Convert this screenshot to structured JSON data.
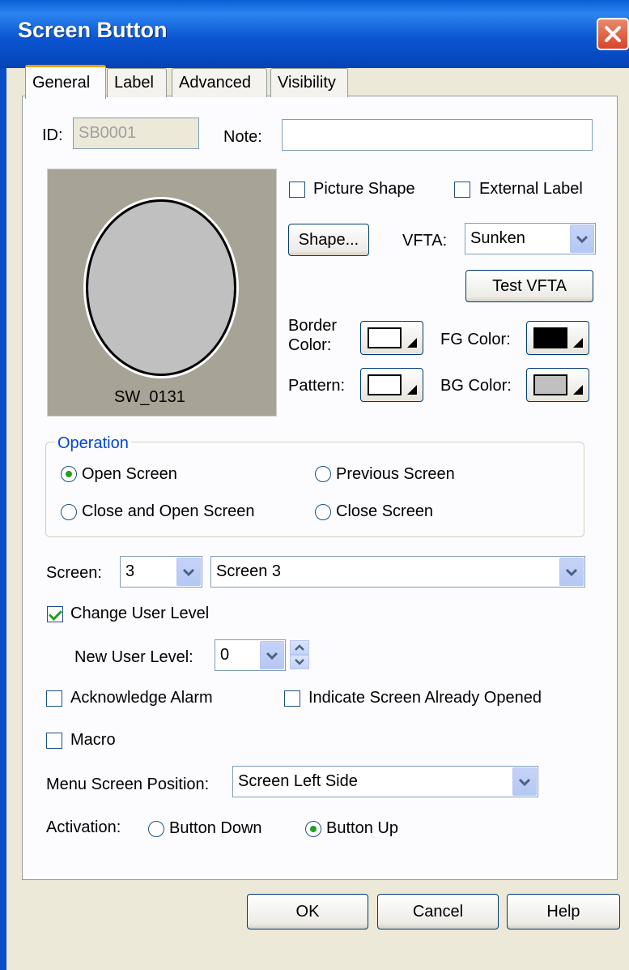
{
  "window": {
    "title": "Screen Button",
    "close_label": "Close"
  },
  "tabs": [
    {
      "label": "General",
      "active": true
    },
    {
      "label": "Label",
      "active": false
    },
    {
      "label": "Advanced",
      "active": false
    },
    {
      "label": "Visibility",
      "active": false
    }
  ],
  "general": {
    "id_label": "ID:",
    "id_value": "SB0001",
    "note_label": "Note:",
    "note_value": "",
    "preview_caption": "SW_0131",
    "picture_shape_label": "Picture Shape",
    "picture_shape_checked": false,
    "external_label_label": "External Label",
    "external_label_checked": false,
    "shape_button": "Shape...",
    "vfta_label": "VFTA:",
    "vfta_value": "Sunken",
    "test_vfta_button": "Test VFTA",
    "border_color_label_1": "Border",
    "border_color_label_2": "Color:",
    "fg_color_label": "FG Color:",
    "pattern_label": "Pattern:",
    "bg_color_label": "BG Color:",
    "colors": {
      "border": "#ffffff",
      "fg": "#000000",
      "pattern": "#ffffff",
      "bg": "#c0c0c0",
      "preview_bg": "#a7a396",
      "preview_circle": "#c0c0c0"
    }
  },
  "operation": {
    "legend": "Operation",
    "options": [
      {
        "label": "Open Screen",
        "checked": true
      },
      {
        "label": "Previous Screen",
        "checked": false
      },
      {
        "label": "Close and Open Screen",
        "checked": false
      },
      {
        "label": "Close Screen",
        "checked": false
      }
    ]
  },
  "screen": {
    "label": "Screen:",
    "number_value": "3",
    "name_value": "Screen 3"
  },
  "user_level": {
    "change_label": "Change User Level",
    "change_checked": true,
    "new_level_label": "New User Level:",
    "new_level_value": "0"
  },
  "acknowledge_alarm": {
    "label": "Acknowledge Alarm",
    "checked": false
  },
  "indicate_opened": {
    "label": "Indicate Screen Already Opened",
    "checked": false
  },
  "macro": {
    "label": "Macro",
    "checked": false
  },
  "menu_position": {
    "label": "Menu Screen Position:",
    "value": "Screen Left Side"
  },
  "activation": {
    "label": "Activation:",
    "options": [
      {
        "label": "Button Down",
        "checked": false
      },
      {
        "label": "Button Up",
        "checked": true
      }
    ]
  },
  "footer": {
    "ok": "OK",
    "cancel": "Cancel",
    "help": "Help"
  }
}
